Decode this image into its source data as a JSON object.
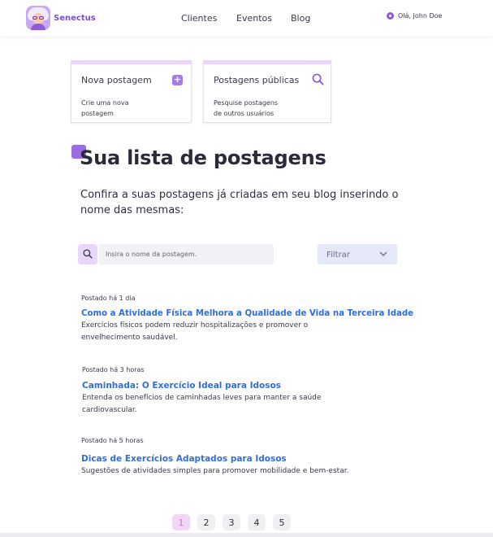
{
  "brand": {
    "name": "Senectus"
  },
  "nav": {
    "clientes": "Clientes",
    "eventos": "Eventos",
    "blog": "Blog"
  },
  "user": {
    "greeting": "Olá, John Doe"
  },
  "cards": {
    "new_post": {
      "title": "Nova postagem",
      "description": "Crie uma nova postagem",
      "icon": "plus-icon"
    },
    "public_posts": {
      "title": "Postagens públicas",
      "description": "Pesquise  postagens de outros usuários",
      "icon": "search-icon"
    }
  },
  "page": {
    "title": "Sua lista de postagens",
    "subtitle": "Confira a suas postagens já criadas em seu blog inserindo o nome das mesmas:"
  },
  "search": {
    "placeholder": "Insira o nome da postagem.",
    "value": ""
  },
  "filter": {
    "label": "Filtrar"
  },
  "posts": [
    {
      "meta": "Postado há 1 dia",
      "title": "Como a Atividade Física Melhora a Qualidade de Vida na Terceira Idade",
      "excerpt": "Exercícios físicos podem reduzir hospitalizações e promover o envelhecimento saudável."
    },
    {
      "meta": "Postado há 3 horas",
      "title": "Caminhada: O Exercício Ideal para Idosos",
      "excerpt": "Entenda os benefícios de caminhadas leves para manter a saúde cardiovascular."
    },
    {
      "meta": "Postado há 5 horas",
      "title": "Dicas de Exercícios Adaptados para Idosos",
      "excerpt": "Sugestões de atividades simples para promover mobilidade e bem-estar."
    }
  ],
  "pagination": {
    "pages": [
      "1",
      "2",
      "3",
      "4",
      "5"
    ],
    "current": "1"
  },
  "colors": {
    "accent": "#8e5cd8",
    "link": "#2f6fd6",
    "card_top": "#e8d6fb"
  }
}
